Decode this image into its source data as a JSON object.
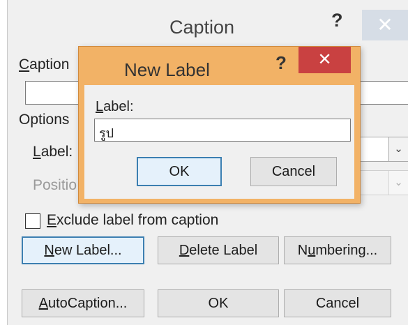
{
  "caption_dialog": {
    "title": "Caption",
    "help_glyph": "?",
    "close_glyph": "✕",
    "caption_label": "Caption",
    "caption_value": "",
    "options_label": "Options",
    "label_label": "Label:",
    "label_value": "",
    "position_label": "Positio",
    "position_value": "",
    "exclude_label": "Exclude label from caption",
    "exclude_checked": false,
    "buttons": {
      "new_label": "New Label...",
      "delete_label": "Delete Label",
      "numbering": "Numbering...",
      "autocaption": "AutoCaption...",
      "ok": "OK",
      "cancel": "Cancel"
    }
  },
  "new_label_dialog": {
    "title": "New Label",
    "help_glyph": "?",
    "close_glyph": "✕",
    "label_label": "Label:",
    "input_value": "รูป",
    "ok": "OK",
    "cancel": "Cancel"
  },
  "icons": {
    "dropdown_arrow": "⌄"
  },
  "colors": {
    "dialog_bg": "#f0f0f0",
    "active_frame": "#f2b266",
    "close_red": "#c94141",
    "inactive_close": "#d6dde6",
    "focus_border": "#3c7fb1"
  }
}
